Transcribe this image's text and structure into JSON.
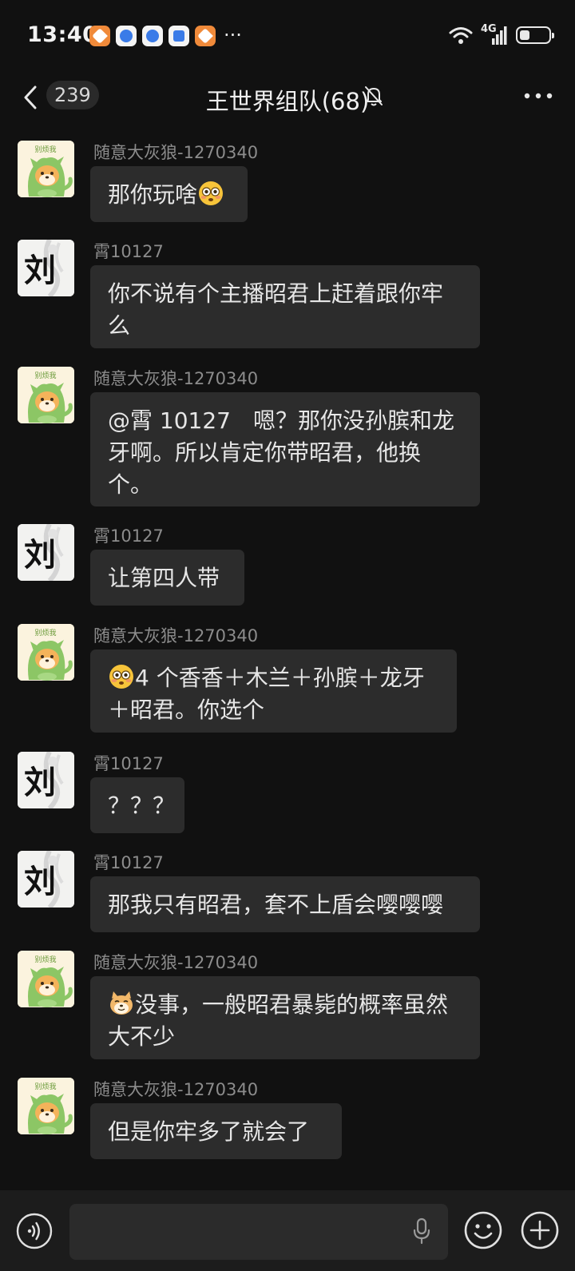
{
  "status_bar": {
    "time": "13:40",
    "network": "4G",
    "battery_level": 0.35,
    "app_icons": [
      "orange-app-icon",
      "blue-browser-icon",
      "blue-browser-icon-2",
      "blue-app-icon",
      "orange-app-icon-2"
    ],
    "more_indicator": "···"
  },
  "header": {
    "unread_count": "239",
    "title": "王世界组队(68)",
    "muted": true
  },
  "messages": [
    {
      "sender": "随意大灰狼-1270340",
      "avatar": "dino",
      "text": "那你玩啥",
      "emoji_after": "flushed"
    },
    {
      "sender": "霄10127",
      "avatar": "liu",
      "lines": [
        "你不说有个主播昭君上赶着跟你牢",
        "么"
      ]
    },
    {
      "sender": "随意大灰狼-1270340",
      "avatar": "dino",
      "lines": [
        "@霄 10127　嗯？那你没孙膑和龙",
        "牙啊。所以肯定你带昭君，他换",
        "个。"
      ]
    },
    {
      "sender": "霄10127",
      "avatar": "liu",
      "text": "让第四人带"
    },
    {
      "sender": "随意大灰狼-1270340",
      "avatar": "dino",
      "emoji_before": "flushed",
      "lines": [
        "4 个香香＋木兰＋孙膑＋龙牙",
        "＋昭君。你选个"
      ]
    },
    {
      "sender": "霄10127",
      "avatar": "liu",
      "text": "？？？"
    },
    {
      "sender": "霄10127",
      "avatar": "liu",
      "text": "那我只有昭君，套不上盾会嘤嘤嘤"
    },
    {
      "sender": "随意大灰狼-1270340",
      "avatar": "dino",
      "emoji_before": "doge",
      "lines": [
        "没事，一般昭君暴毙的概率虽然",
        "大不少"
      ]
    },
    {
      "sender": "随意大灰狼-1270340",
      "avatar": "dino",
      "text": "但是你牢多了就会了"
    }
  ],
  "avatar_text": {
    "dino": "别烦我",
    "liu": "刘"
  },
  "input": {
    "placeholder": "",
    "value": ""
  },
  "icons": {
    "back": "chevron-left-icon",
    "mute": "bell-off-icon",
    "more": "more-horizontal-icon",
    "voice": "voice-icon",
    "mic": "microphone-icon",
    "emoji": "smiley-icon",
    "plus": "plus-circle-icon"
  },
  "colors": {
    "background": "#111111",
    "bubble": "#2c2c2c",
    "sender_name": "#8c8c8c",
    "input_bar": "#1c1c1c"
  }
}
